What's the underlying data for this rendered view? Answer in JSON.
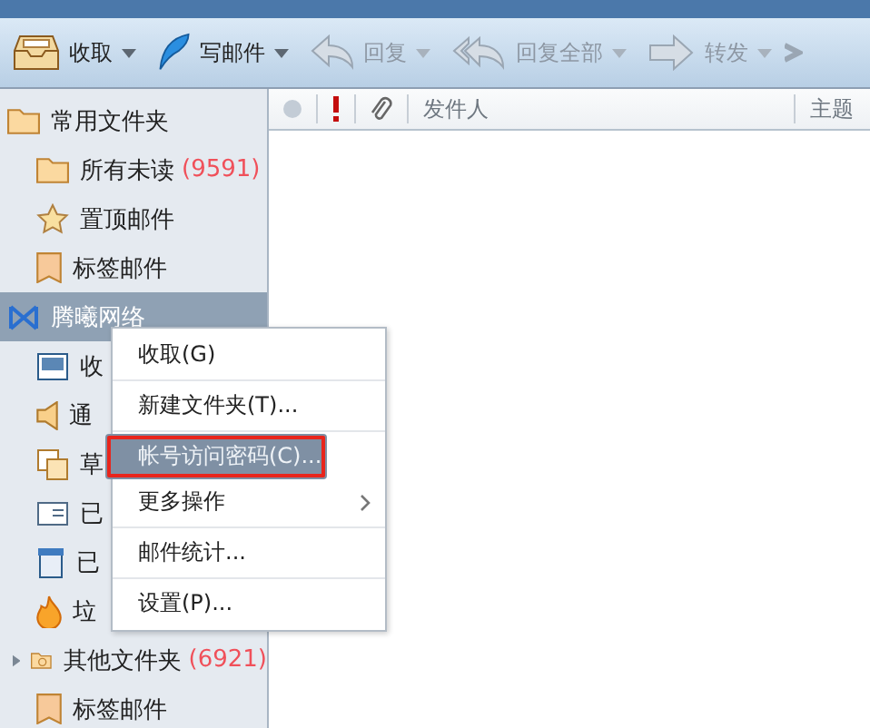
{
  "toolbar": {
    "buttons": [
      {
        "label": "收取",
        "kind": "inbox",
        "disabled": false
      },
      {
        "label": "写邮件",
        "kind": "quill",
        "disabled": false
      },
      {
        "label": "回复",
        "kind": "reply",
        "disabled": true
      },
      {
        "label": "回复全部",
        "kind": "reply-all",
        "disabled": true
      },
      {
        "label": "转发",
        "kind": "forward",
        "disabled": true
      }
    ]
  },
  "sidebar": {
    "items": [
      {
        "label": "常用文件夹",
        "kind": "folder",
        "selected": false,
        "expander": false,
        "children": [
          {
            "label": "所有未读",
            "count": "(9591)",
            "kind": "folder",
            "selected": false,
            "expander": false
          },
          {
            "label": "置顶邮件",
            "kind": "star",
            "selected": false,
            "expander": false
          },
          {
            "label": "标签邮件",
            "kind": "tag",
            "selected": false,
            "expander": false
          }
        ]
      },
      {
        "label": "腾曦网络",
        "kind": "account",
        "selected": true,
        "expander": false,
        "children": [
          {
            "label": "收",
            "kind": "inbox-box",
            "selected": false,
            "expander": false
          },
          {
            "label": "通",
            "kind": "speaker",
            "selected": false,
            "expander": false
          },
          {
            "label": "草",
            "kind": "drafts",
            "selected": false,
            "expander": false
          },
          {
            "label": "已",
            "kind": "sent",
            "selected": false,
            "expander": false
          },
          {
            "label": "已",
            "kind": "trash",
            "selected": false,
            "expander": false
          },
          {
            "label": "垃",
            "kind": "fire",
            "selected": false,
            "expander": false
          },
          {
            "label": "其他文件夹",
            "count": "(6921)",
            "kind": "folder-other",
            "selected": false,
            "expander": true
          },
          {
            "label": "标签邮件",
            "kind": "tag-other",
            "selected": false,
            "expander": false
          }
        ]
      }
    ]
  },
  "list_header": {
    "columns": [
      "发件人",
      "主题"
    ]
  },
  "context_menu": {
    "items": [
      {
        "label": "收取(G)",
        "selected": false,
        "submenu": false,
        "outlined": false,
        "divider_after": true
      },
      {
        "label": "新建文件夹(T)...",
        "selected": false,
        "submenu": false,
        "outlined": false,
        "divider_after": true
      },
      {
        "label": "帐号访问密码(C)...",
        "selected": true,
        "submenu": false,
        "outlined": true,
        "divider_after": false
      },
      {
        "label": "更多操作",
        "selected": false,
        "submenu": true,
        "outlined": false,
        "divider_after": true
      },
      {
        "label": "邮件统计...",
        "selected": false,
        "submenu": false,
        "outlined": false,
        "divider_after": true
      },
      {
        "label": "设置(P)...",
        "selected": false,
        "submenu": false,
        "outlined": false,
        "divider_after": false
      }
    ]
  }
}
